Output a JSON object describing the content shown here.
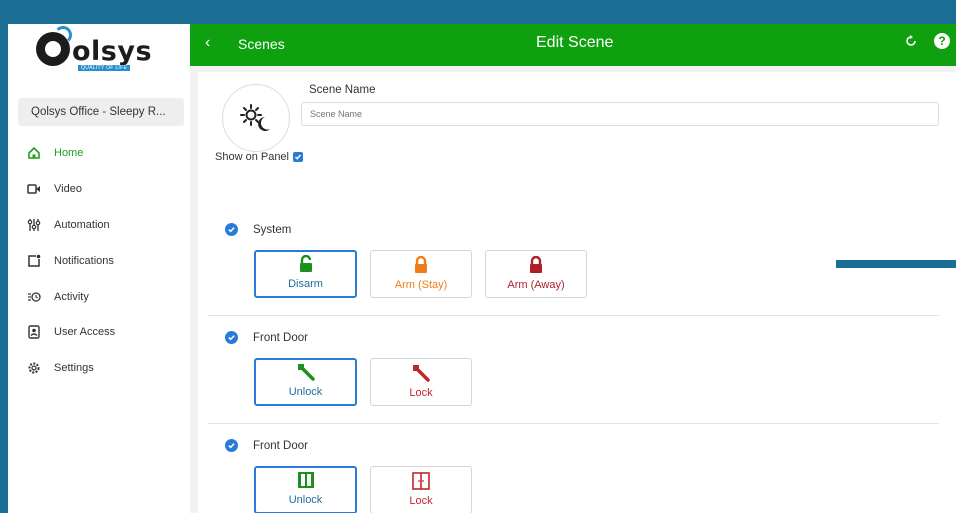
{
  "brand": {
    "logo_text": "olsys",
    "logo_tag": "QUALITY OF LIFE"
  },
  "sidebar": {
    "location": "Qolsys Office - Sleepy R...",
    "items": [
      {
        "label": "Home",
        "icon": "home-icon",
        "active": true
      },
      {
        "label": "Video",
        "icon": "video-icon",
        "active": false
      },
      {
        "label": "Automation",
        "icon": "sliders-icon",
        "active": false
      },
      {
        "label": "Notifications",
        "icon": "notification-icon",
        "active": false
      },
      {
        "label": "Activity",
        "icon": "activity-icon",
        "active": false
      },
      {
        "label": "User Access",
        "icon": "user-access-icon",
        "active": false
      },
      {
        "label": "Settings",
        "icon": "gear-icon",
        "active": false
      }
    ]
  },
  "header": {
    "back_label": "Scenes",
    "title": "Edit Scene"
  },
  "form": {
    "scene_name_label": "Scene Name",
    "scene_name_placeholder": "Scene Name",
    "scene_name_value": "",
    "show_on_panel_label": "Show on Panel",
    "show_on_panel_checked": true
  },
  "sections": [
    {
      "title": "System",
      "options": [
        {
          "label": "Disarm",
          "icon": "unlocked-padlock-icon",
          "color": "#1e8f1e",
          "selected": true
        },
        {
          "label": "Arm (Stay)",
          "icon": "locked-padlock-icon",
          "color": "#f07d1a",
          "selected": false
        },
        {
          "label": "Arm (Away)",
          "icon": "locked-padlock-icon",
          "color": "#b01e2a",
          "selected": false
        }
      ]
    },
    {
      "title": "Front Door",
      "options": [
        {
          "label": "Unlock",
          "icon": "key-icon",
          "color": "#1e8f1e",
          "selected": true
        },
        {
          "label": "Lock",
          "icon": "key-icon",
          "color": "#c0262c",
          "selected": false
        }
      ]
    },
    {
      "title": "Front Door",
      "options": [
        {
          "label": "Unlock",
          "icon": "door-icon",
          "color": "#1e8f1e",
          "selected": true
        },
        {
          "label": "Lock",
          "icon": "door-icon",
          "color": "#c0262c",
          "selected": false
        }
      ]
    }
  ],
  "colors": {
    "header_green": "#0fa00f",
    "accent_blue": "#2a7bd8",
    "frame_blue": "#1a6e94"
  }
}
